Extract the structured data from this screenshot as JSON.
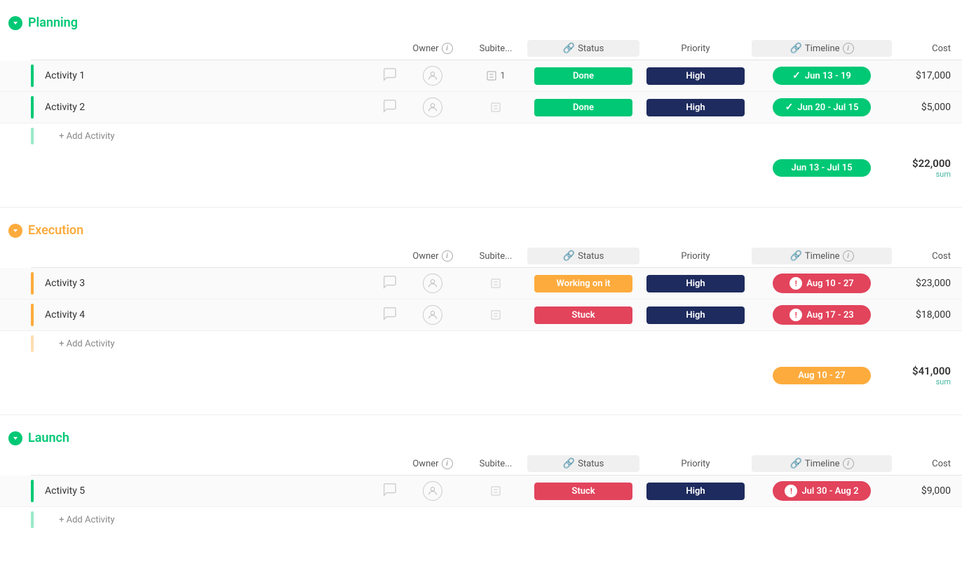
{
  "groups": [
    {
      "id": "planning",
      "title": "Planning",
      "titleColor": "#00c875",
      "chevronColor": "#00c875",
      "barColor": "#00c875",
      "activities": [
        {
          "name": "Activity 1",
          "hasSubitem": true,
          "subitemCount": "1",
          "statusLabel": "Done",
          "statusClass": "status-done",
          "priorityLabel": "High",
          "timelineLabel": "Jun 13 - 19",
          "timelineClass": "timeline-green",
          "timelineIcon": "check",
          "cost": "$17,000"
        },
        {
          "name": "Activity 2",
          "hasSubitem": false,
          "subitemCount": "",
          "statusLabel": "Done",
          "statusClass": "status-done",
          "priorityLabel": "High",
          "timelineLabel": "Jun 20 - Jul 15",
          "timelineClass": "timeline-green",
          "timelineIcon": "check",
          "cost": "$5,000"
        }
      ],
      "addActivityLabel": "+ Add Activity",
      "summaryTimelineLabel": "Jun 13 - Jul 15",
      "summaryTimelineClass": "timeline-green",
      "summaryCostValue": "$22,000",
      "summaryCostLabel": "sum"
    },
    {
      "id": "execution",
      "title": "Execution",
      "titleColor": "#fdab3d",
      "chevronColor": "#fdab3d",
      "barColor": "#fdab3d",
      "activities": [
        {
          "name": "Activity 3",
          "hasSubitem": false,
          "subitemCount": "",
          "statusLabel": "Working on it",
          "statusClass": "status-working",
          "priorityLabel": "High",
          "timelineLabel": "Aug 10 - 27",
          "timelineClass": "timeline-red",
          "timelineIcon": "exclaim",
          "cost": "$23,000"
        },
        {
          "name": "Activity 4",
          "hasSubitem": false,
          "subitemCount": "",
          "statusLabel": "Stuck",
          "statusClass": "status-stuck",
          "priorityLabel": "High",
          "timelineLabel": "Aug 17 - 23",
          "timelineClass": "timeline-red",
          "timelineIcon": "exclaim",
          "cost": "$18,000"
        }
      ],
      "addActivityLabel": "+ Add Activity",
      "summaryTimelineLabel": "Aug 10 - 27",
      "summaryTimelineClass": "timeline-orange",
      "summaryCostValue": "$41,000",
      "summaryCostLabel": "sum"
    },
    {
      "id": "launch",
      "title": "Launch",
      "titleColor": "#00c875",
      "chevronColor": "#00c875",
      "barColor": "#00c875",
      "activities": [
        {
          "name": "Activity 5",
          "hasSubitem": false,
          "subitemCount": "",
          "statusLabel": "Stuck",
          "statusClass": "status-stuck",
          "priorityLabel": "High",
          "timelineLabel": "Jul 30 - Aug 2",
          "timelineClass": "timeline-red",
          "timelineIcon": "exclaim",
          "cost": "$9,000"
        }
      ],
      "addActivityLabel": "+ Add Activity",
      "summaryTimelineLabel": "",
      "summaryCostValue": "",
      "summaryCostLabel": ""
    }
  ],
  "columns": {
    "owner": "Owner",
    "subitem": "Subite...",
    "status": "Status",
    "priority": "Priority",
    "timeline": "Timeline",
    "cost": "Cost"
  }
}
